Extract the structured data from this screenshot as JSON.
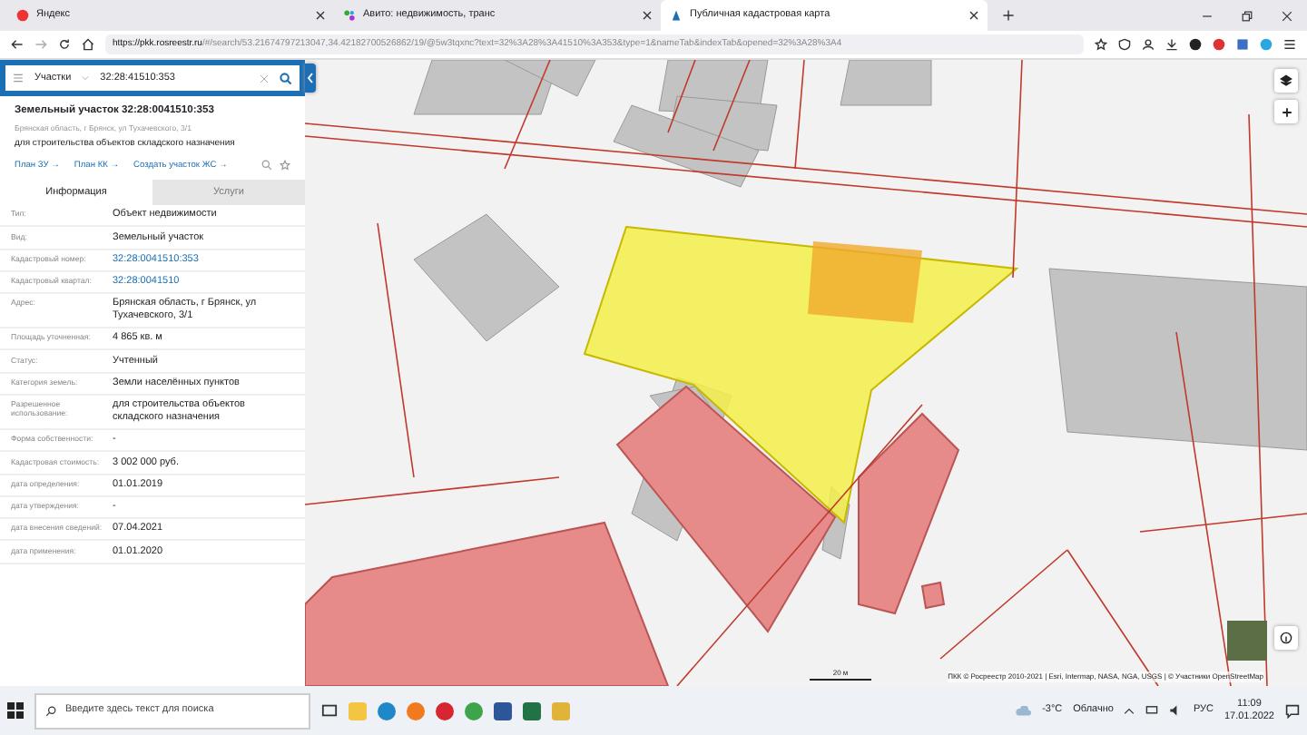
{
  "browser": {
    "tabs": [
      {
        "title": "Яндекс",
        "selected": false,
        "kind": "yandex"
      },
      {
        "title": "Авито: недвижимость, транс",
        "selected": false,
        "kind": "avito"
      },
      {
        "title": "Публичная кадастровая карта",
        "selected": true,
        "kind": "pkk"
      }
    ],
    "url_host": "https://pkk.rosreestr.ru",
    "url_path": "/#/search/53.21674797213047,34.42182700526862/19/@5w3tqxnc?text=32%3A28%3A41510%3A353&type=1&nameTab&indexTab&opened=32%3A28%3A4"
  },
  "panel": {
    "search": {
      "category": "Участки",
      "value": "32:28:41510:353"
    },
    "title": "Земельный участок 32:28:0041510:353",
    "address": "Брянская область, г Брянск, ул Тухачевского, 3/1",
    "purpose": "для строительства объектов складского назначения",
    "links": [
      "План ЗУ →",
      "План КК →",
      "Создать участок ЖС →"
    ],
    "tabs": [
      {
        "label": "Информация",
        "selected": true
      },
      {
        "label": "Услуги",
        "selected": false
      }
    ],
    "rows": [
      {
        "label": "Тип:",
        "value": "Объект недвижимости",
        "kind": "text"
      },
      {
        "label": "Вид:",
        "value": "Земельный участок",
        "kind": "text"
      },
      {
        "label": "Кадастровый номер:",
        "value": "32:28:0041510:353",
        "kind": "link"
      },
      {
        "label": "Кадастровый квартал:",
        "value": "32:28:0041510",
        "kind": "link"
      },
      {
        "label": "Адрес:",
        "value": "Брянская область, г Брянск, ул Тухачевского, 3/1",
        "kind": "text"
      },
      {
        "label": "Площадь уточненная:",
        "value": "4 865 кв. м",
        "kind": "text"
      },
      {
        "label": "Статус:",
        "value": "Учтенный",
        "kind": "text"
      },
      {
        "label": "Категория земель:",
        "value": "Земли населённых пунктов",
        "kind": "text"
      },
      {
        "label": "Разрешенное использование:",
        "value": "для строительства объектов складского назначения",
        "kind": "text"
      },
      {
        "label": "Форма собственности:",
        "value": "-",
        "kind": "text"
      },
      {
        "label": "Кадастровая стоимость:",
        "value": "3 002 000 руб.",
        "kind": "text"
      },
      {
        "label": "дата определения:",
        "value": "01.01.2019",
        "kind": "text"
      },
      {
        "label": "дата утверждения:",
        "value": "-",
        "kind": "text"
      },
      {
        "label": "дата внесения сведений:",
        "value": "07.04.2021",
        "kind": "text"
      },
      {
        "label": "дата применения:",
        "value": "01.01.2020",
        "kind": "text"
      }
    ]
  },
  "map": {
    "scale": "20 м",
    "attribution": "ПКК © Росреестр 2010-2021 | Esri, Intermap, NASA, NGA, USGS | © Участники OpenStreetMap"
  },
  "taskbar": {
    "search_placeholder": "Введите здесь текст для поиска",
    "temperature": "-3°C",
    "weather": "Облачно",
    "language": "РУС",
    "time": "11:09",
    "date": "17.01.2022"
  }
}
